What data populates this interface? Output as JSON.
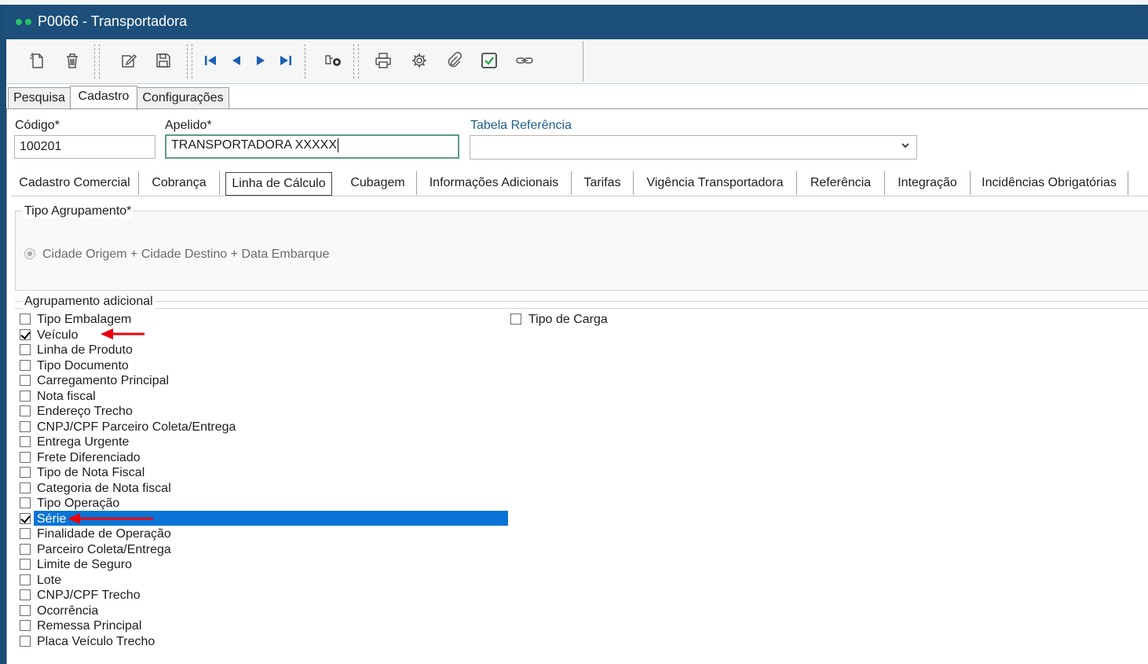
{
  "window": {
    "title": "P0066 - Transportadora"
  },
  "toolbar": {
    "buttons": [
      {
        "icon": "new-document-icon"
      },
      {
        "icon": "trash-icon"
      },
      {
        "icon": "edit-icon"
      },
      {
        "icon": "save-icon"
      },
      {
        "icon": "first-record-icon"
      },
      {
        "icon": "previous-record-icon"
      },
      {
        "icon": "next-record-icon"
      },
      {
        "icon": "last-record-icon"
      },
      {
        "icon": "binoculars-search-icon"
      },
      {
        "icon": "print-icon"
      },
      {
        "icon": "gear-icon"
      },
      {
        "icon": "paperclip-icon"
      },
      {
        "icon": "checkbox-icon"
      },
      {
        "icon": "link-icon"
      }
    ]
  },
  "main_tabs": [
    {
      "label": "Pesquisa",
      "active": false
    },
    {
      "label": "Cadastro",
      "active": true
    },
    {
      "label": "Configurações",
      "active": false
    }
  ],
  "form": {
    "codigo_label": "Código*",
    "codigo_value": "100201",
    "apelido_label": "Apelido*",
    "apelido_value": "TRANSPORTADORA XXXXX",
    "tabela_label": "Tabela Referência",
    "tabela_value": ""
  },
  "sub_tabs": [
    {
      "label": "Cadastro Comercial"
    },
    {
      "label": "Cobrança"
    },
    {
      "label": "Linha de Cálculo",
      "active": true
    },
    {
      "label": "Cubagem"
    },
    {
      "label": "Informações Adicionais"
    },
    {
      "label": "Tarifas"
    },
    {
      "label": "Vigência Transportadora"
    },
    {
      "label": "Referência"
    },
    {
      "label": "Integração"
    },
    {
      "label": "Incidências Obrigatórias"
    }
  ],
  "tipo_agrupamento": {
    "label": "Tipo Agrupamento*",
    "option": "Cidade Origem + Cidade Destino + Data Embarque"
  },
  "agrupamento_adicional": {
    "label": "Agrupamento adicional",
    "left_items": [
      {
        "label": "Tipo Embalagem",
        "checked": false
      },
      {
        "label": "Veículo",
        "checked": true
      },
      {
        "label": "Linha de Produto",
        "checked": false
      },
      {
        "label": "Tipo Documento",
        "checked": false
      },
      {
        "label": "Carregamento Principal",
        "checked": false
      },
      {
        "label": "Nota fiscal",
        "checked": false
      },
      {
        "label": "Endereço Trecho",
        "checked": false
      },
      {
        "label": "CNPJ/CPF Parceiro Coleta/Entrega",
        "checked": false
      },
      {
        "label": "Entrega Urgente",
        "checked": false
      },
      {
        "label": "Frete Diferenciado",
        "checked": false
      },
      {
        "label": "Tipo de Nota Fiscal",
        "checked": false
      },
      {
        "label": "Categoria de Nota fiscal",
        "checked": false
      },
      {
        "label": "Tipo Operação",
        "checked": false
      },
      {
        "label": "Série",
        "checked": true,
        "selected": true
      },
      {
        "label": "Finalidade de Operação",
        "checked": false
      },
      {
        "label": "Parceiro Coleta/Entrega",
        "checked": false
      },
      {
        "label": "Limite de Seguro",
        "checked": false
      },
      {
        "label": "Lote",
        "checked": false
      },
      {
        "label": "CNPJ/CPF Trecho",
        "checked": false
      },
      {
        "label": "Ocorrência",
        "checked": false
      },
      {
        "label": "Remessa Principal",
        "checked": false
      },
      {
        "label": "Placa Veículo Trecho",
        "checked": false
      }
    ],
    "right_items": [
      {
        "label": "Tipo de Carga",
        "checked": false
      }
    ]
  },
  "colors": {
    "title_bar": "#1c4f79",
    "selection": "#0a74d6",
    "annotation_arrow": "#e8000b"
  }
}
